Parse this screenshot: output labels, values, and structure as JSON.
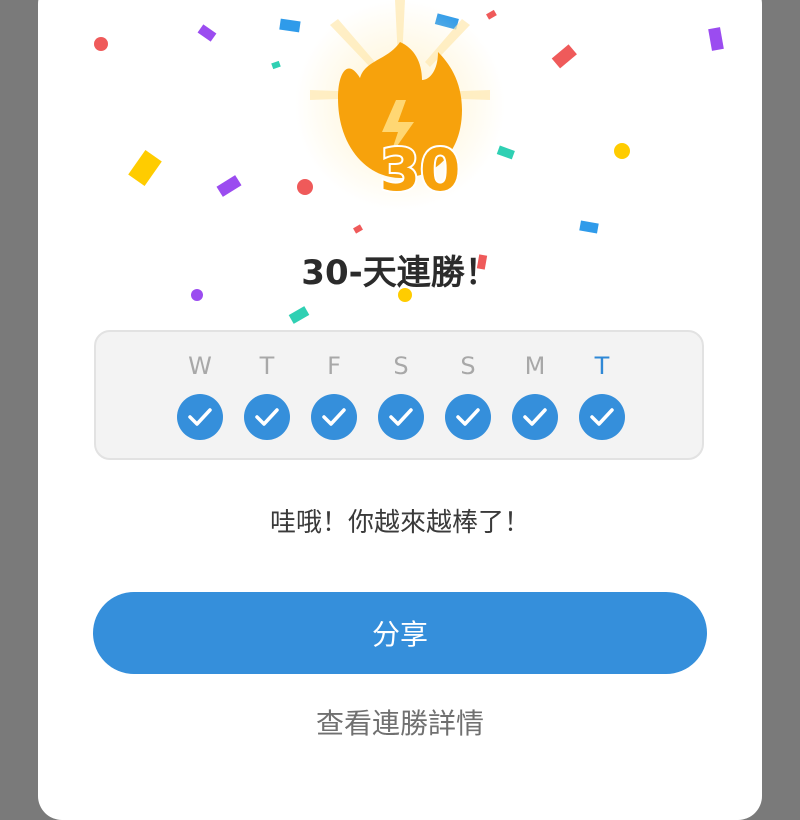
{
  "streak": {
    "count": "30",
    "title": "30-天連勝！",
    "days": [
      {
        "letter": "W",
        "today": false,
        "done": true
      },
      {
        "letter": "T",
        "today": false,
        "done": true
      },
      {
        "letter": "F",
        "today": false,
        "done": true
      },
      {
        "letter": "S",
        "today": false,
        "done": true
      },
      {
        "letter": "S",
        "today": false,
        "done": true
      },
      {
        "letter": "M",
        "today": false,
        "done": true
      },
      {
        "letter": "T",
        "today": true,
        "done": true
      }
    ],
    "message": "哇哦！你越來越棒了！"
  },
  "actions": {
    "share_label": "分享",
    "details_label": "查看連勝詳情"
  },
  "icons": {
    "hero": "flame-bolt-icon",
    "check": "check-icon"
  },
  "colors": {
    "accent": "#358fdb",
    "flame": "#f7a20c",
    "today_letter": "#2f88d6"
  }
}
